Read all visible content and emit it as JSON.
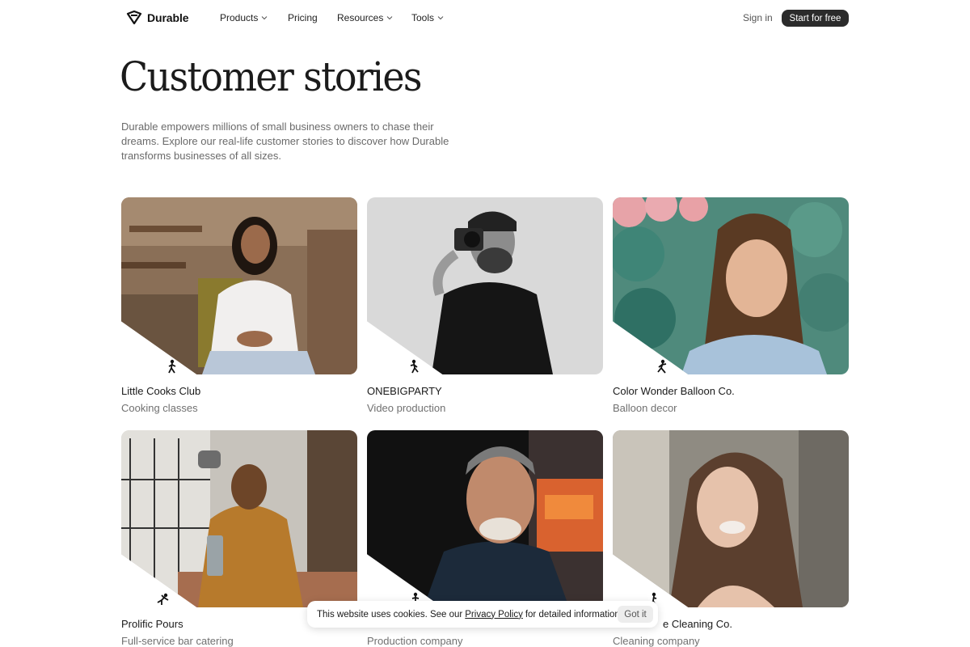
{
  "nav": {
    "brand": "Durable",
    "links": [
      {
        "label": "Products"
      },
      {
        "label": "Pricing"
      },
      {
        "label": "Resources"
      },
      {
        "label": "Tools"
      }
    ],
    "sign_in": "Sign in",
    "cta": "Start for free"
  },
  "hero": {
    "title": "Customer stories",
    "description": "Durable empowers millions of small business owners to chase their dreams. Explore our real-life customer stories to discover how Durable transforms businesses of all sizes."
  },
  "stories": [
    {
      "name": "Little Cooks Club",
      "category": "Cooking classes"
    },
    {
      "name": "ONEBIGPARTY",
      "category": "Video production"
    },
    {
      "name": "Color Wonder Balloon Co.",
      "category": "Balloon decor"
    },
    {
      "name": "Prolific Pours",
      "category": "Full-service bar catering"
    },
    {
      "name": "",
      "category": "Production company"
    },
    {
      "name": "e Cleaning Co.",
      "category": "Cleaning company"
    }
  ],
  "cookie": {
    "text_before": "This website uses cookies. See our",
    "link": "Privacy Policy",
    "text_after": "for detailed information.",
    "button": "Got it"
  },
  "colors": {
    "cta_bg": "#2b2b2b",
    "text_muted": "#707070"
  }
}
